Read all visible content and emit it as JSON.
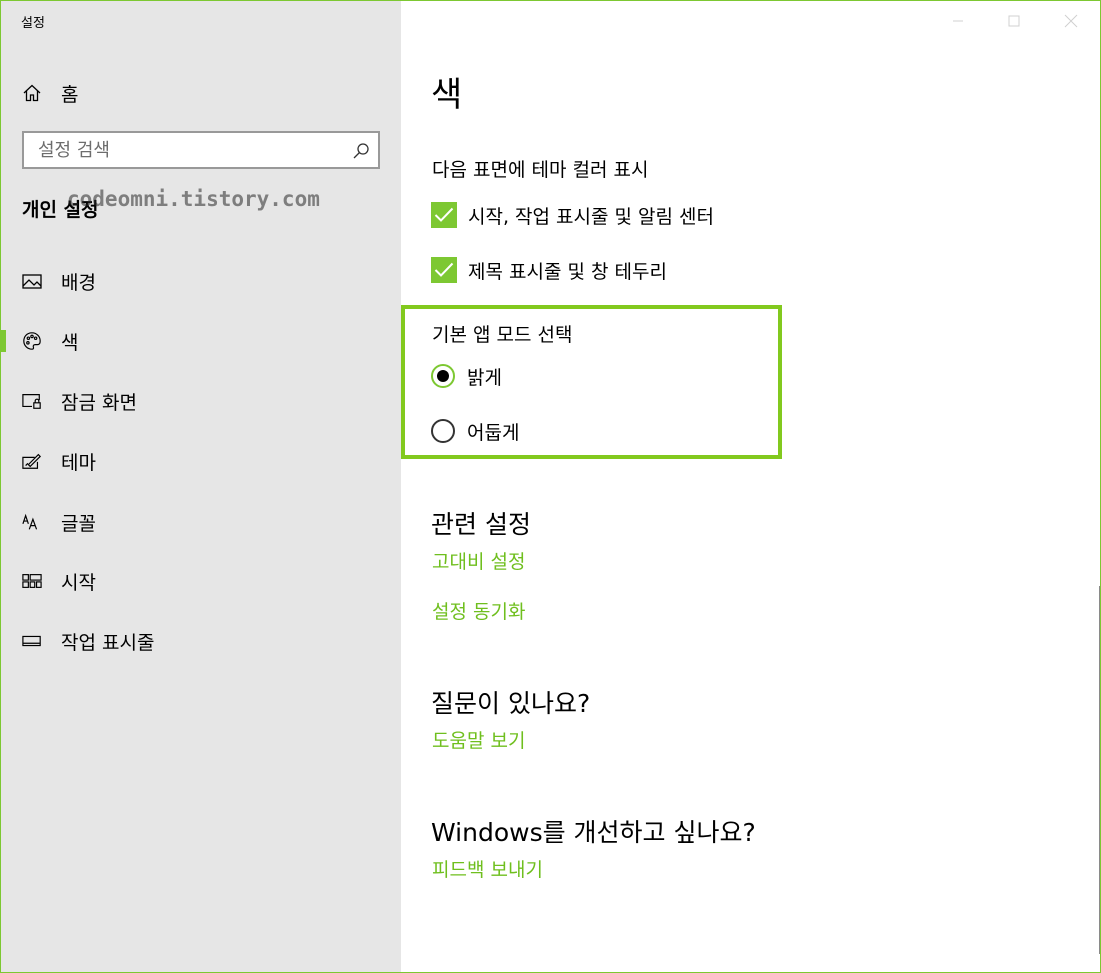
{
  "window": {
    "title": "설정"
  },
  "sidebar": {
    "home_label": "홈",
    "search_placeholder": "설정 검색",
    "section_heading": "개인 설정",
    "watermark": "codeomni.tistory.com",
    "items": [
      {
        "label": "배경",
        "icon": "picture-icon"
      },
      {
        "label": "색",
        "icon": "palette-icon",
        "selected": true
      },
      {
        "label": "잠금 화면",
        "icon": "lock-screen-icon"
      },
      {
        "label": "테마",
        "icon": "theme-brush-icon"
      },
      {
        "label": "글꼴",
        "icon": "font-icon"
      },
      {
        "label": "시작",
        "icon": "start-tiles-icon"
      },
      {
        "label": "작업 표시줄",
        "icon": "taskbar-icon"
      }
    ]
  },
  "main": {
    "title": "색",
    "color_surfaces_heading": "다음 표면에 테마 컬러 표시",
    "checkbox_start": "시작, 작업 표시줄 및 알림 센터",
    "checkbox_titlebar": "제목 표시줄 및 창 테두리",
    "app_mode_heading": "기본 앱 모드 선택",
    "radio_light": "밝게",
    "radio_dark": "어둡게",
    "app_mode_selected": "밝게",
    "related_heading": "관련 설정",
    "link_high_contrast": "고대비 설정",
    "link_sync": "설정 동기화",
    "question_heading": "질문이 있나요?",
    "link_help": "도움말 보기",
    "improve_heading": "Windows를 개선하고 싶나요?",
    "link_feedback": "피드백 보내기"
  },
  "colors": {
    "accent": "#7dc832",
    "link": "#6fbf1e",
    "sidebar_bg": "#e6e6e6"
  }
}
